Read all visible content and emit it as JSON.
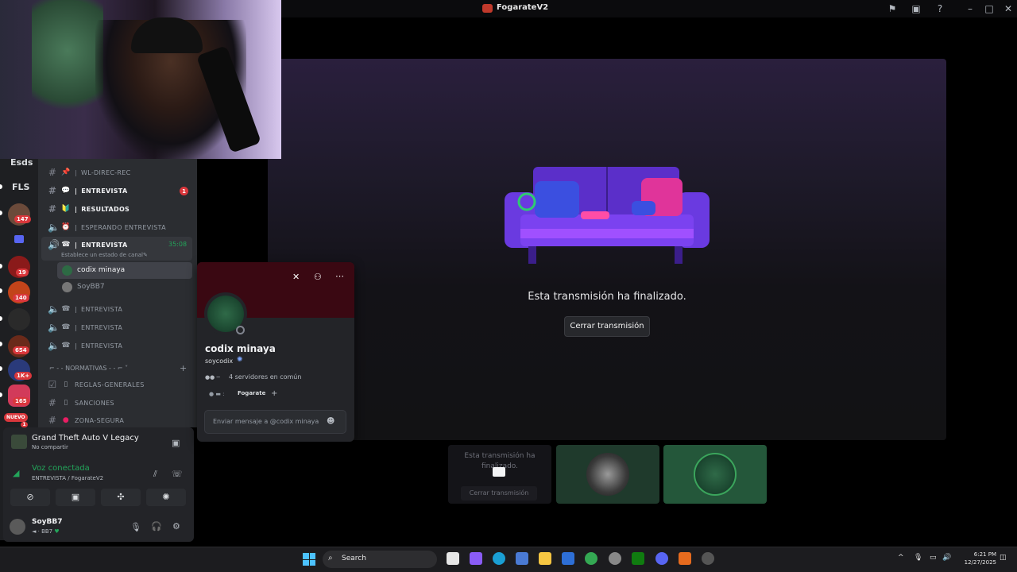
{
  "window": {
    "title": "FogarateV2"
  },
  "servers": {
    "labels": [
      "Esds",
      "FLS"
    ],
    "badges": [
      "147",
      "19",
      "140",
      "654",
      "1K+",
      "165",
      "NUEVO",
      "1"
    ]
  },
  "channels": [
    {
      "name": "WL-DIREC-REC",
      "type": "text",
      "emoji": "📌"
    },
    {
      "name": "ENTREVISTA",
      "type": "text",
      "emoji": "💬",
      "unread": true,
      "mention": "1"
    },
    {
      "name": "RESULTADOS",
      "type": "text",
      "emoji": "🔰",
      "unread": true
    },
    {
      "name": "ESPERANDO ENTREVISTA",
      "type": "voice",
      "emoji": "⏰"
    },
    {
      "name": "ENTREVISTA",
      "type": "voice-active",
      "emoji": "☎",
      "timer": "35:08",
      "status": "Establece un estado de canal"
    },
    {
      "name": "ENTREVISTA",
      "type": "voice",
      "emoji": "☎"
    },
    {
      "name": "ENTREVISTA",
      "type": "voice",
      "emoji": "☎"
    },
    {
      "name": "ENTREVISTA",
      "type": "voice",
      "emoji": "☎"
    }
  ],
  "voice_users": [
    "codix minaya",
    "SoyBB7"
  ],
  "category": {
    "name": "NORMATIVAS"
  },
  "rules_channels": [
    "REGLAS-GENERALES",
    "SANCIONES",
    "ZONA-SEGURA"
  ],
  "activity": {
    "game": "Grand Theft Auto V Legacy",
    "sub": "No compartir"
  },
  "voice": {
    "status": "Voz conectada",
    "channel": "ENTREVISTA / FogarateV2"
  },
  "user": {
    "name": "SoyBB7",
    "tag": "BB7"
  },
  "stream": {
    "ended_text": "Esta transmisión ha finalizado.",
    "close_label": "Cerrar transmisión"
  },
  "tiles": {
    "ended_text": "Esta transmisión ha finalizado.",
    "close_label": "Cerrar transmisión"
  },
  "profile": {
    "display_name": "codix minaya",
    "username": "soycodix",
    "mutual": "4 servidores en común",
    "server": "Fogarate",
    "message_placeholder": "Enviar mensaje a @codix minaya"
  },
  "taskbar": {
    "search": "Search",
    "time": "6:21 PM",
    "date": "12/27/2025"
  },
  "colors": {
    "accent_green": "#23a55a",
    "mention_red": "#da373c",
    "banner": "#3a0812"
  }
}
